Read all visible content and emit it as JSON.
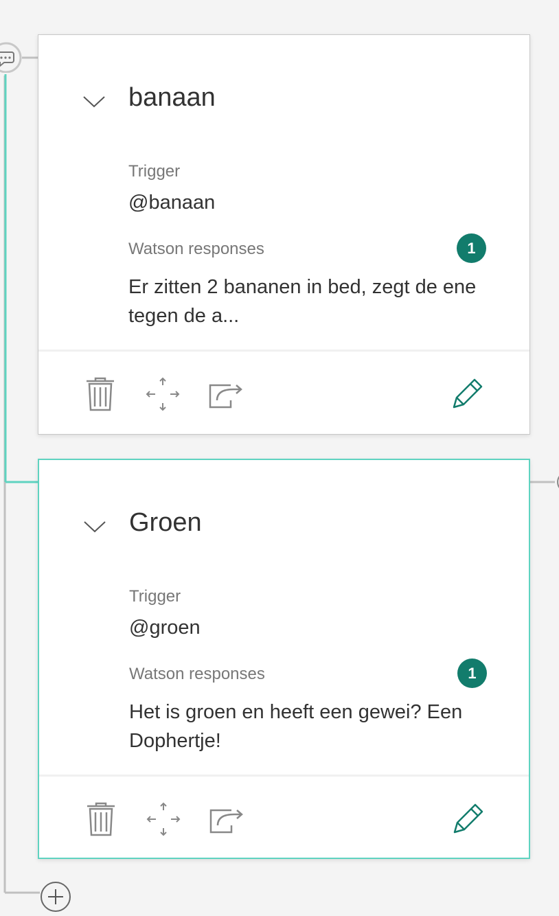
{
  "nodes": [
    {
      "title": "banaan",
      "trigger_label": "Trigger",
      "trigger_value": "@banaan",
      "responses_label": "Watson responses",
      "responses_count": "1",
      "response_preview": "Er zitten 2 bananen in bed, zegt de ene tegen de a...",
      "selected": false
    },
    {
      "title": "Groen",
      "trigger_label": "Trigger",
      "trigger_value": "@groen",
      "responses_label": "Watson responses",
      "responses_count": "1",
      "response_preview": "Het is groen en heeft een gewei? Een Dophertje!",
      "selected": true
    }
  ],
  "icons": {
    "node_type": "speech-bubble-icon",
    "collapse": "chevron-down-icon",
    "delete": "trash-icon",
    "move": "move-arrows-icon",
    "jump": "jump-to-icon",
    "edit": "pencil-icon",
    "add": "plus-circle-icon"
  },
  "colors": {
    "accent": "#5fd3c0",
    "badge": "#127c6c",
    "edit_icon": "#127c6c",
    "connector": "#c0c0c0",
    "icon_gray": "#888888"
  }
}
